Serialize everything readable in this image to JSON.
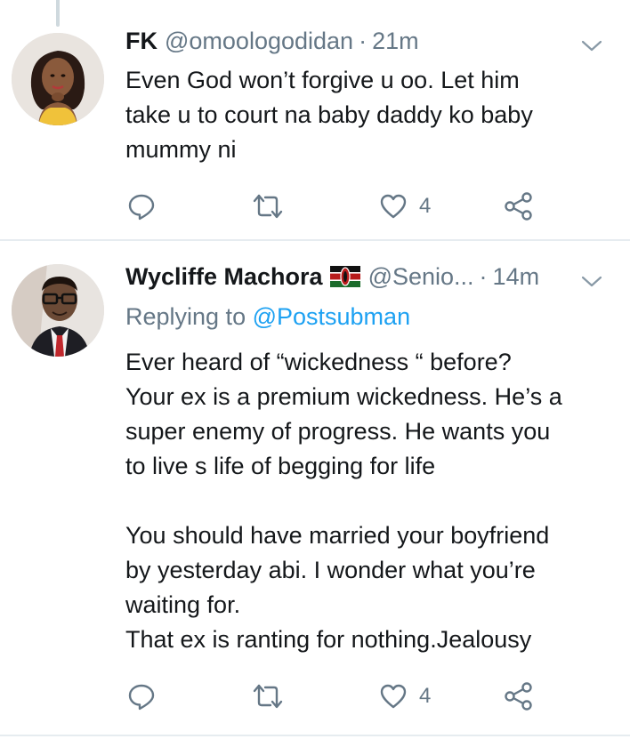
{
  "tweets": [
    {
      "display_name": "FK",
      "handle": "@omoologodidan",
      "separator": "·",
      "time": "21m",
      "text": "Even God won’t forgive u oo. Let him\ntake u to court na baby daddy ko baby\nmummy ni",
      "like_count": "4"
    },
    {
      "display_name": "Wycliffe Machora",
      "handle": "@Senio...",
      "separator": "·",
      "time": "14m",
      "reply_prefix": "Replying to ",
      "reply_mention": "@Postsubman",
      "text": "Ever heard of “wickedness “ before?\nYour ex is a premium wickedness. He’s a\nsuper enemy of progress. He wants you\nto live s life of begging for life\n\nYou should have married your boyfriend\nby yesterday abi. I wonder what you’re\nwaiting for.\nThat ex is ranting for nothing.Jealousy",
      "like_count": "4"
    }
  ],
  "colors": {
    "text": "#14171a",
    "secondary": "#657786",
    "accent": "#1da1f2",
    "divider": "#e6ecf0"
  },
  "icons": [
    "reply-icon",
    "retweet-icon",
    "like-icon",
    "share-icon",
    "chevron-down-icon",
    "kenya-flag-icon"
  ]
}
